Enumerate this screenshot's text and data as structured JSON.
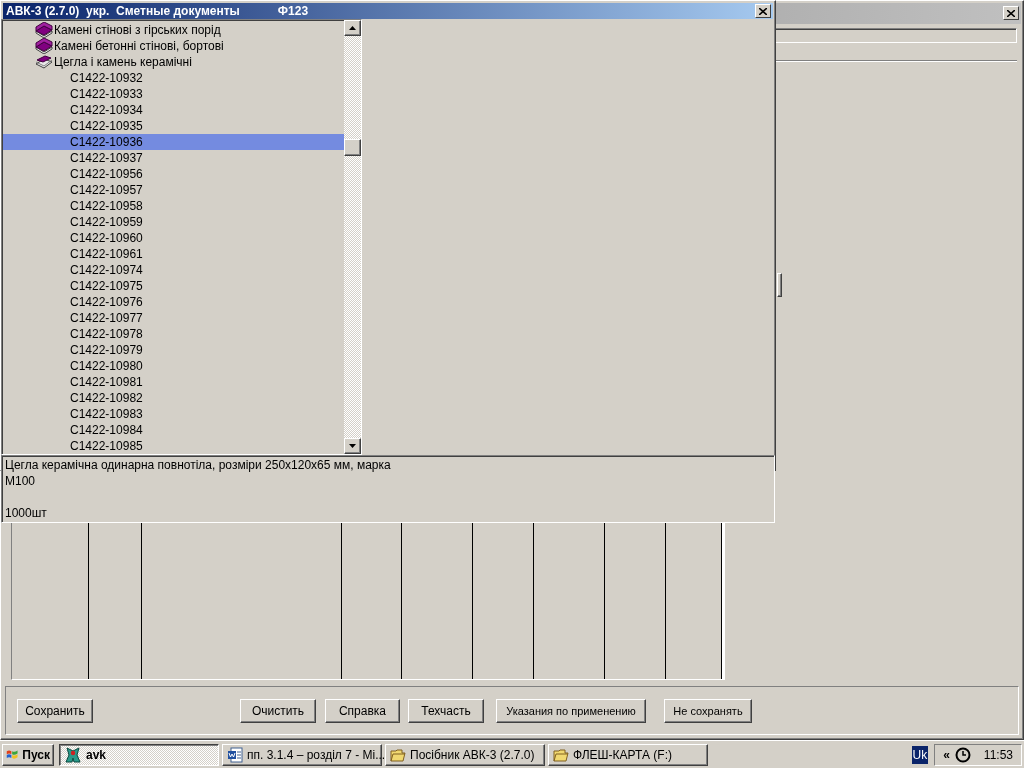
{
  "background_window": {
    "active": false
  },
  "dialog": {
    "active": true,
    "title": "АВК-3 (2.7.0)  укр.  Сметные документы",
    "form_code": "Ф123",
    "tree": [
      {
        "label": "Камені стінові з гірських порід",
        "expanded": false,
        "selected": false
      },
      {
        "label": "Камені бетонні стінові, бортові",
        "expanded": false,
        "selected": false
      },
      {
        "label": "Цегла і камень керамічні",
        "expanded": true,
        "selected": false,
        "children": [
          {
            "label": "С1422-10932",
            "selected": false
          },
          {
            "label": "С1422-10933",
            "selected": false
          },
          {
            "label": "С1422-10934",
            "selected": false
          },
          {
            "label": "С1422-10935",
            "selected": false
          },
          {
            "label": "С1422-10936",
            "selected": true
          },
          {
            "label": "С1422-10937",
            "selected": false
          },
          {
            "label": "С1422-10956",
            "selected": false
          },
          {
            "label": "С1422-10957",
            "selected": false
          },
          {
            "label": "С1422-10958",
            "selected": false
          },
          {
            "label": "С1422-10959",
            "selected": false
          },
          {
            "label": "С1422-10960",
            "selected": false
          },
          {
            "label": "С1422-10961",
            "selected": false
          },
          {
            "label": "С1422-10974",
            "selected": false
          },
          {
            "label": "С1422-10975",
            "selected": false
          },
          {
            "label": "С1422-10976",
            "selected": false
          },
          {
            "label": "С1422-10977",
            "selected": false
          },
          {
            "label": "С1422-10978",
            "selected": false
          },
          {
            "label": "С1422-10979",
            "selected": false
          },
          {
            "label": "С1422-10980",
            "selected": false
          },
          {
            "label": "С1422-10981",
            "selected": false
          },
          {
            "label": "С1422-10982",
            "selected": false
          },
          {
            "label": "С1422-10983",
            "selected": false
          },
          {
            "label": "С1422-10984",
            "selected": false
          },
          {
            "label": "С1422-10985",
            "selected": false
          }
        ]
      }
    ],
    "description": {
      "text": "Цегла керамічна одинарна повнотіла, розміри 250x120x65 мм, марка М100",
      "quantity": "1000шт"
    }
  },
  "buttons": [
    {
      "label": "Сохранить"
    },
    {
      "label": "Очистить"
    },
    {
      "label": "Справка"
    },
    {
      "label": "Техчасть"
    },
    {
      "label": "Указания по применению"
    },
    {
      "label": "Не сохранять"
    }
  ],
  "taskbar": {
    "start_button": {
      "label": "Пуск"
    },
    "tasks": [
      {
        "label": "avk",
        "kind": "app",
        "selected": true
      },
      {
        "label": "пп. 3.1.4 – розділ 7 - Mi...",
        "kind": "document",
        "selected": false
      },
      {
        "label": "Посібник АВК-3 (2.7.0)",
        "kind": "folder",
        "selected": false
      },
      {
        "label": "ФЛЕШ-КАРТА (F:)",
        "kind": "folder",
        "selected": false
      }
    ],
    "language": "Uk",
    "tray_expand": "«",
    "clock": "11:53"
  }
}
